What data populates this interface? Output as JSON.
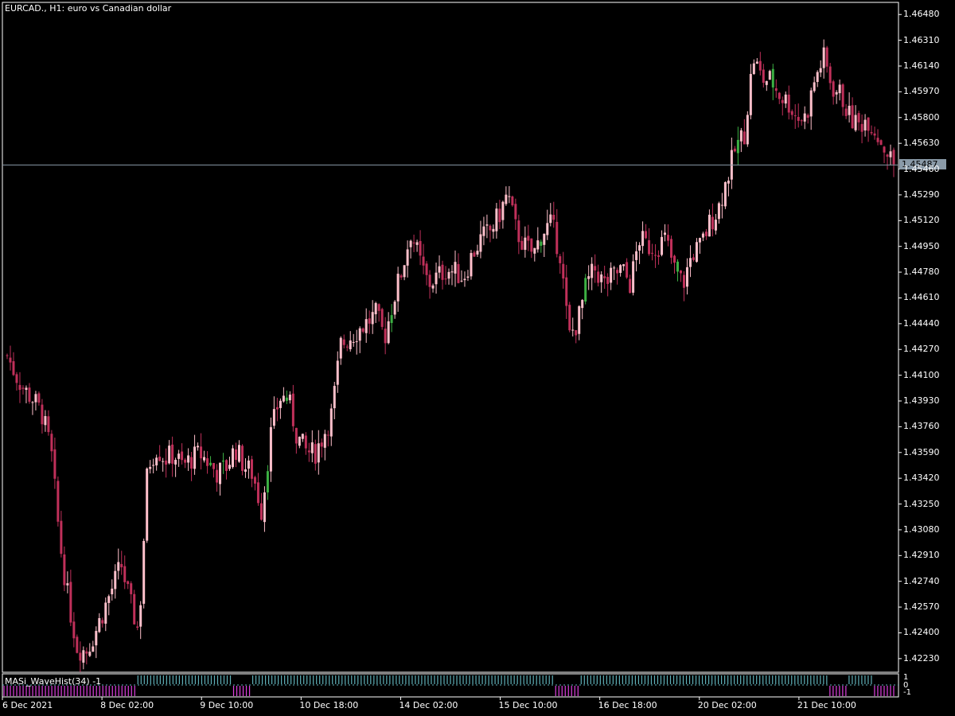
{
  "header": {
    "symbol": "EURCAD.",
    "timeframe": "H1",
    "description": "euro vs Canadian dollar",
    "title_text": "EURCAD., H1:  euro vs Canadian dollar"
  },
  "current_price": "1.45487",
  "price_axis": {
    "labels": [
      "1.46480",
      "1.46310",
      "1.46140",
      "1.45970",
      "1.45800",
      "1.45630",
      "1.45460",
      "1.45290",
      "1.45120",
      "1.44950",
      "1.44780",
      "1.44610",
      "1.44440",
      "1.44270",
      "1.44100",
      "1.43930",
      "1.43760",
      "1.43590",
      "1.43420",
      "1.43250",
      "1.43080",
      "1.42910",
      "1.42740",
      "1.42570",
      "1.42400",
      "1.42230"
    ]
  },
  "time_axis": {
    "labels": [
      "6 Dec 2021",
      "8 Dec 02:00",
      "9 Dec 10:00",
      "10 Dec 18:00",
      "14 Dec 02:00",
      "15 Dec 10:00",
      "16 Dec 18:00",
      "20 Dec 02:00",
      "21 Dec 10:00"
    ]
  },
  "indicator": {
    "name": "MASi_WaveHist(34) -1",
    "scale_labels": [
      "1",
      "0",
      "-1"
    ]
  },
  "colors": {
    "background": "#000000",
    "bull_candle": "#ffc0cb",
    "bear_candle": "#c0305a",
    "alt_candle": "#3cb043",
    "grid_line": "#ffffff",
    "price_line": "#8a9aa8",
    "hist_positive": "#5fb0b8",
    "hist_negative": "#e040e0"
  },
  "chart_data": {
    "type": "candlestick",
    "symbol": "EURCAD.",
    "timeframe": "H1",
    "ylim": [
      1.4214,
      1.4656
    ],
    "x": [
      "6 Dec 2021",
      "8 Dec 02:00",
      "9 Dec 10:00",
      "10 Dec 18:00",
      "14 Dec 02:00",
      "15 Dec 10:00",
      "16 Dec 18:00",
      "20 Dec 02:00",
      "21 Dec 10:00"
    ],
    "close_path": [
      1.4423,
      1.441,
      1.44,
      1.4394,
      1.4384,
      1.436,
      1.43,
      1.426,
      1.423,
      1.4228,
      1.424,
      1.4255,
      1.427,
      1.4285,
      1.426,
      1.424,
      1.435,
      1.4362,
      1.4355,
      1.4358,
      1.435,
      1.4355,
      1.4358,
      1.4352,
      1.4345,
      1.435,
      1.4362,
      1.435,
      1.4345,
      1.432,
      1.437,
      1.4395,
      1.4395,
      1.437,
      1.436,
      1.4358,
      1.437,
      1.4385,
      1.443,
      1.4435,
      1.444,
      1.4445,
      1.445,
      1.4435,
      1.446,
      1.448,
      1.4505,
      1.4485,
      1.447,
      1.4475,
      1.448,
      1.4478,
      1.4475,
      1.449,
      1.45,
      1.4505,
      1.4515,
      1.453,
      1.4505,
      1.4495,
      1.449,
      1.4505,
      1.451,
      1.449,
      1.4435,
      1.4445,
      1.447,
      1.448,
      1.447,
      1.4475,
      1.448,
      1.447,
      1.45,
      1.4495,
      1.4495,
      1.45,
      1.448,
      1.447,
      1.449,
      1.4495,
      1.451,
      1.452,
      1.454,
      1.456,
      1.457,
      1.462,
      1.4605,
      1.4605,
      1.4595,
      1.459,
      1.458,
      1.458,
      1.4605,
      1.462,
      1.46,
      1.4595,
      1.458,
      1.4575,
      1.458,
      1.457,
      1.456,
      1.4549
    ],
    "indicator_series": {
      "name": "MASi_WaveHist(34) -1",
      "regime": [
        -1,
        -1,
        -1,
        -1,
        -1,
        -1,
        -1,
        -1,
        -1,
        -1,
        -1,
        -1,
        -1,
        -1,
        -1,
        -1,
        1,
        1,
        1,
        1,
        1,
        1,
        1,
        1,
        1,
        1,
        1,
        -1,
        -1,
        1,
        1,
        1,
        1,
        1,
        1,
        1,
        1,
        1,
        1,
        1,
        1,
        1,
        1,
        1,
        1,
        1,
        1,
        1,
        1,
        1,
        1,
        1,
        1,
        1,
        1,
        1,
        1,
        1,
        1,
        1,
        1,
        1,
        1,
        1,
        -1,
        -1,
        -1,
        1,
        1,
        1,
        1,
        1,
        1,
        1,
        1,
        1,
        1,
        1,
        1,
        1,
        1,
        1,
        1,
        1,
        1,
        1,
        1,
        1,
        1,
        1,
        1,
        1,
        1,
        1,
        1,
        1,
        -1,
        -1,
        1,
        1,
        1,
        -1,
        -1,
        -1
      ]
    }
  }
}
